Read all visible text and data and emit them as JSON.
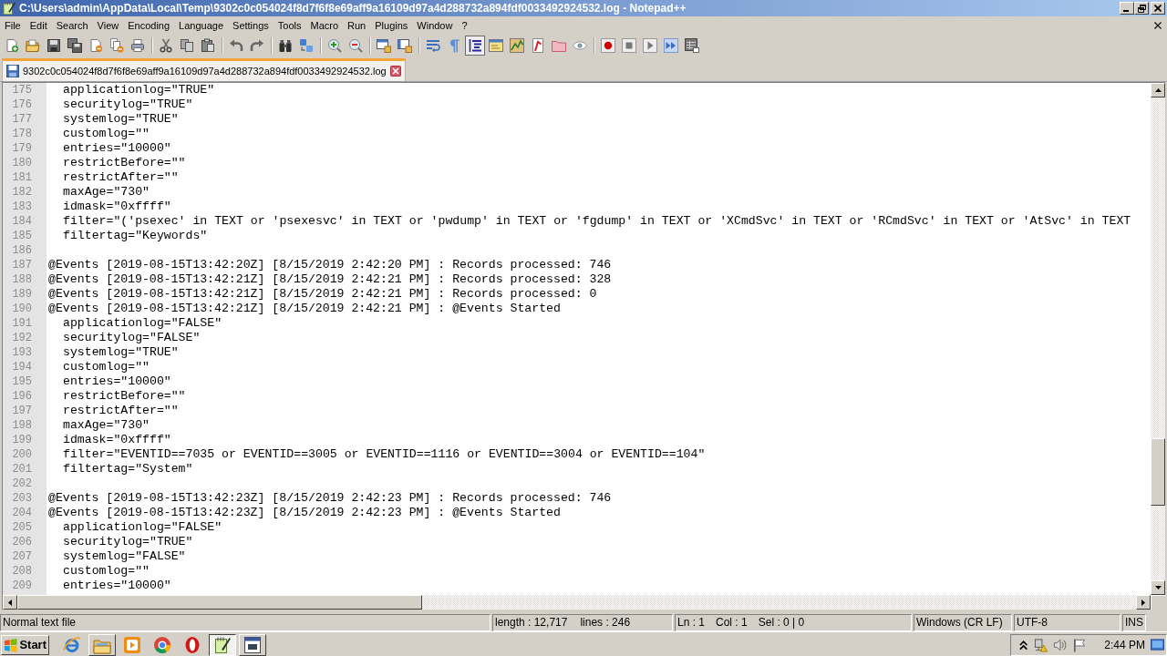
{
  "window": {
    "title": "C:\\Users\\admin\\AppData\\Local\\Temp\\9302c0c054024f8d7f6f8e69aff9a16109d97a4d288732a894fdf0033492924532.log - Notepad++"
  },
  "menu": [
    "File",
    "Edit",
    "Search",
    "View",
    "Encoding",
    "Language",
    "Settings",
    "Tools",
    "Macro",
    "Run",
    "Plugins",
    "Window",
    "?"
  ],
  "toolbar": [
    {
      "pressed": false
    },
    {
      "pressed": false
    },
    {
      "pressed": false
    },
    {
      "pressed": false
    },
    {
      "pressed": false
    },
    {
      "pressed": false
    },
    {
      "pressed": false
    },
    {
      "pressed": false
    },
    {
      "pressed": false
    },
    {
      "pressed": false
    },
    {
      "pressed": false
    },
    {
      "pressed": false
    },
    {
      "pressed": false
    },
    {
      "pressed": false
    },
    {
      "pressed": false
    },
    {
      "pressed": false
    },
    {
      "pressed": false
    },
    {
      "pressed": false
    },
    {
      "pressed": false
    },
    {
      "pressed": false
    },
    {
      "pressed": true
    },
    {
      "pressed": false
    },
    {
      "pressed": false
    },
    {
      "pressed": false
    },
    {
      "pressed": false
    },
    {
      "pressed": false
    },
    {
      "pressed": false
    },
    {
      "pressed": false
    },
    {
      "pressed": false
    },
    {
      "pressed": false
    },
    {
      "pressed": false
    }
  ],
  "tabs": [
    {
      "label": "9302c0c054024f8d7f6f8e69aff9a16109d97a4d288732a894fdf0033492924532.log",
      "selected": true
    }
  ],
  "editor": {
    "lines": [
      {
        "number": "175",
        "indented": true,
        "text": "applicationlog=\"TRUE\""
      },
      {
        "number": "176",
        "indented": true,
        "text": "securitylog=\"TRUE\""
      },
      {
        "number": "177",
        "indented": true,
        "text": "systemlog=\"TRUE\""
      },
      {
        "number": "178",
        "indented": true,
        "text": "customlog=\"\""
      },
      {
        "number": "179",
        "indented": true,
        "text": "entries=\"10000\""
      },
      {
        "number": "180",
        "indented": true,
        "text": "restrictBefore=\"\""
      },
      {
        "number": "181",
        "indented": true,
        "text": "restrictAfter=\"\""
      },
      {
        "number": "182",
        "indented": true,
        "text": "maxAge=\"730\""
      },
      {
        "number": "183",
        "indented": true,
        "text": "idmask=\"0xffff\""
      },
      {
        "number": "184",
        "indented": true,
        "text": "filter=\"('psexec' in TEXT or 'psexesvc' in TEXT or 'pwdump' in TEXT or 'fgdump' in TEXT or 'XCmdSvc' in TEXT or 'RCmdSvc' in TEXT or 'AtSvc' in TEXT"
      },
      {
        "number": "185",
        "indented": true,
        "text": "filtertag=\"Keywords\""
      },
      {
        "number": "186"
      },
      {
        "number": "187",
        "indented": false,
        "text": "@Events [2019-08-15T13:42:20Z] [8/15/2019 2:42:20 PM] : Records processed: 746"
      },
      {
        "number": "188",
        "indented": false,
        "text": "@Events [2019-08-15T13:42:21Z] [8/15/2019 2:42:21 PM] : Records processed: 328"
      },
      {
        "number": "189",
        "indented": false,
        "text": "@Events [2019-08-15T13:42:21Z] [8/15/2019 2:42:21 PM] : Records processed: 0"
      },
      {
        "number": "190",
        "indented": false,
        "text": "@Events [2019-08-15T13:42:21Z] [8/15/2019 2:42:21 PM] : @Events Started"
      },
      {
        "number": "191",
        "indented": true,
        "text": "applicationlog=\"FALSE\""
      },
      {
        "number": "192",
        "indented": true,
        "text": "securitylog=\"FALSE\""
      },
      {
        "number": "193",
        "indented": true,
        "text": "systemlog=\"TRUE\""
      },
      {
        "number": "194",
        "indented": true,
        "text": "customlog=\"\""
      },
      {
        "number": "195",
        "indented": true,
        "text": "entries=\"10000\""
      },
      {
        "number": "196",
        "indented": true,
        "text": "restrictBefore=\"\""
      },
      {
        "number": "197",
        "indented": true,
        "text": "restrictAfter=\"\""
      },
      {
        "number": "198",
        "indented": true,
        "text": "maxAge=\"730\""
      },
      {
        "number": "199",
        "indented": true,
        "text": "idmask=\"0xffff\""
      },
      {
        "number": "200",
        "indented": true,
        "text": "filter=\"EVENTID==7035 or EVENTID==3005 or EVENTID==1116 or EVENTID==3004 or EVENTID==104\""
      },
      {
        "number": "201",
        "indented": true,
        "text": "filtertag=\"System\""
      },
      {
        "number": "202"
      },
      {
        "number": "203",
        "indented": false,
        "text": "@Events [2019-08-15T13:42:23Z] [8/15/2019 2:42:23 PM] : Records processed: 746"
      },
      {
        "number": "204",
        "indented": false,
        "text": "@Events [2019-08-15T13:42:23Z] [8/15/2019 2:42:23 PM] : @Events Started"
      },
      {
        "number": "205",
        "indented": true,
        "text": "applicationlog=\"FALSE\""
      },
      {
        "number": "206",
        "indented": true,
        "text": "securitylog=\"TRUE\""
      },
      {
        "number": "207",
        "indented": true,
        "text": "systemlog=\"FALSE\""
      },
      {
        "number": "208",
        "indented": true,
        "text": "customlog=\"\""
      },
      {
        "number": "209",
        "indented": true,
        "text": "entries=\"10000\""
      }
    ]
  },
  "status_bar": {
    "file_type": "Normal text file",
    "length": "length : 12,717",
    "lines": "lines : 246",
    "line": "Ln : 1",
    "column": "Col : 1",
    "selection": "Sel : 0 | 0",
    "line_ending": "Windows (CR LF)",
    "encoding": "UTF-8",
    "mode": "INS"
  },
  "taskbar": {
    "start": "Start",
    "apps": [
      {
        "running": false,
        "selected": false
      },
      {
        "running": true,
        "selected": false
      },
      {
        "running": false,
        "selected": false
      },
      {
        "running": false,
        "selected": false
      },
      {
        "running": false,
        "selected": false
      },
      {
        "running": true,
        "selected": true
      },
      {
        "running": true,
        "selected": false
      }
    ],
    "clock": "2:44 PM"
  }
}
